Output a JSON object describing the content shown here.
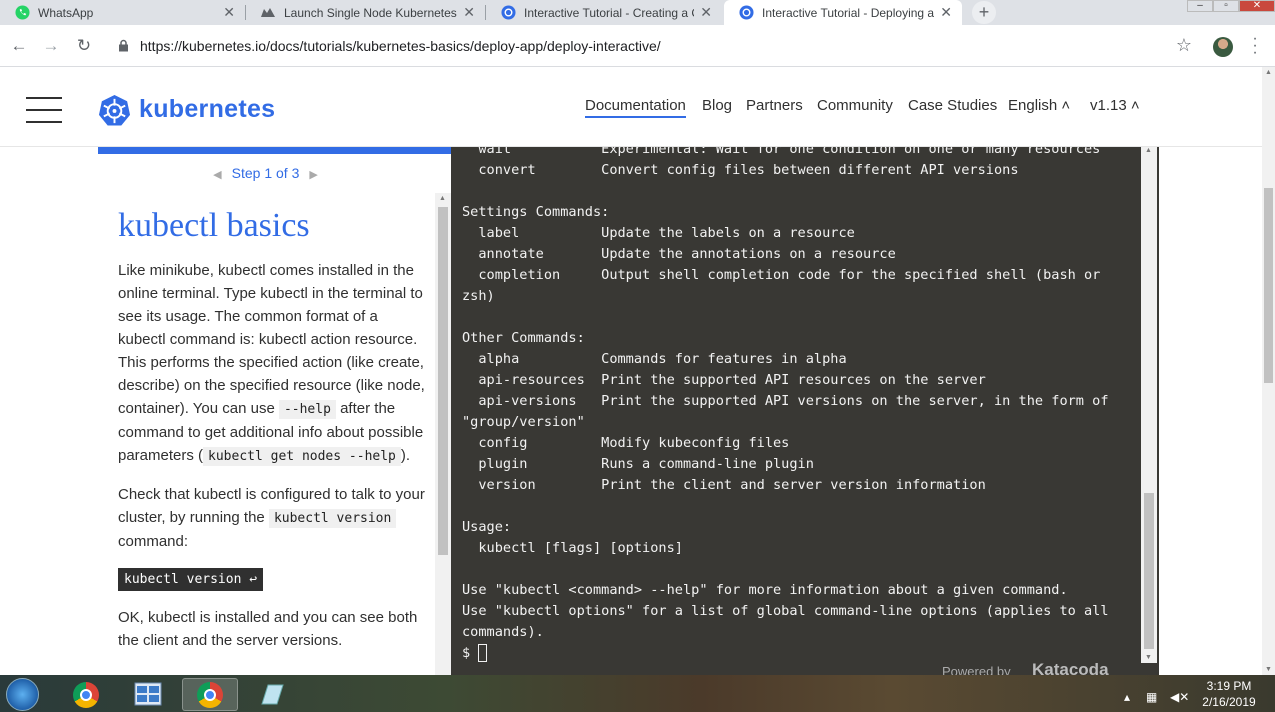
{
  "browser": {
    "tabs": [
      {
        "title": "WhatsApp",
        "icon": "whatsapp-icon",
        "active": false
      },
      {
        "title": "Launch Single Node Kubernetes",
        "icon": "katacoda-icon",
        "active": false
      },
      {
        "title": "Interactive Tutorial - Creating a C",
        "icon": "kubernetes-icon",
        "active": false
      },
      {
        "title": "Interactive Tutorial - Deploying a",
        "icon": "kubernetes-icon",
        "active": true
      }
    ],
    "new_tab_label": "+",
    "url": "https://kubernetes.io/docs/tutorials/kubernetes-basics/deploy-app/deploy-interactive/"
  },
  "header": {
    "brand": "kubernetes",
    "nav": [
      {
        "label": "Documentation",
        "active": true
      },
      {
        "label": "Blog"
      },
      {
        "label": "Partners"
      },
      {
        "label": "Community"
      },
      {
        "label": "Case Studies"
      },
      {
        "label": "English ˄"
      },
      {
        "label": "v1.13 ˄"
      }
    ]
  },
  "tutorial": {
    "step": "Step 1 of 3",
    "title": "kubectl basics",
    "para1_parts": [
      "Like minikube, kubectl comes installed in the online terminal. Type kubectl in the terminal to see its usage. The common format of a kubectl command is: kubectl action resource. This performs the specified action (like create, describe) on the specified resource (like node, container). You can use ",
      "--help",
      " after the command to get additional info about possible parameters (",
      "kubectl get nodes --help",
      ")."
    ],
    "para2_parts": [
      "Check that kubectl is configured to talk to your cluster, by running the ",
      "kubectl version",
      " command:"
    ],
    "run_button": "kubectl version ↩",
    "para3": "OK, kubectl is installed and you can see both the client and the server versions."
  },
  "terminal": {
    "lines": [
      "  wait           Experimental: Wait for one condition on one or many resources",
      "  convert        Convert config files between different API versions",
      "",
      "Settings Commands:",
      "  label          Update the labels on a resource",
      "  annotate       Update the annotations on a resource",
      "  completion     Output shell completion code for the specified shell (bash or",
      "zsh)",
      "",
      "Other Commands:",
      "  alpha          Commands for features in alpha",
      "  api-resources  Print the supported API resources on the server",
      "  api-versions   Print the supported API versions on the server, in the form of",
      "\"group/version\"",
      "  config         Modify kubeconfig files",
      "  plugin         Runs a command-line plugin",
      "  version        Print the client and server version information",
      "",
      "Usage:",
      "  kubectl [flags] [options]",
      "",
      "Use \"kubectl <command> --help\" for more information about a given command.",
      "Use \"kubectl options\" for a list of global command-line options (applies to all",
      "commands)."
    ],
    "prompt": "$",
    "powered_by": "Powered by",
    "katacoda": "Katacoda"
  },
  "taskbar": {
    "time": "3:19 PM",
    "date": "2/16/2019"
  },
  "colors": {
    "k8s_blue": "#326ce5",
    "terminal_bg": "#393834"
  }
}
